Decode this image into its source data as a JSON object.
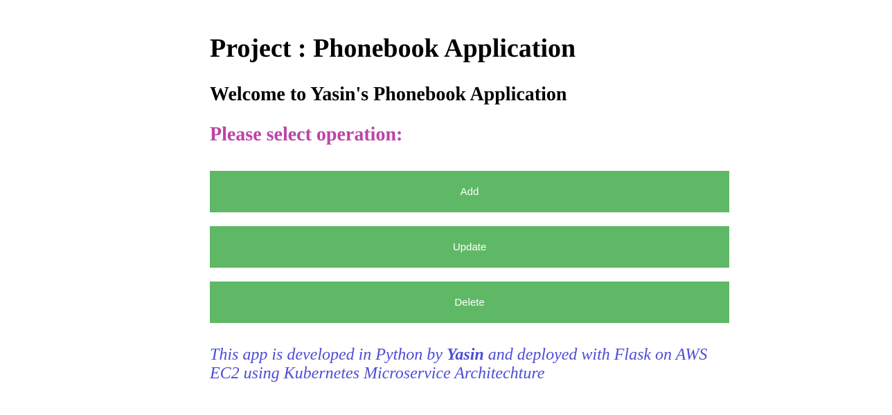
{
  "header": {
    "title": "Project : Phonebook Application",
    "welcome": "Welcome to Yasin's Phonebook Application",
    "prompt": "Please select operation:"
  },
  "operations": [
    {
      "label": "Add"
    },
    {
      "label": "Update"
    },
    {
      "label": "Delete"
    }
  ],
  "footer": {
    "text_before": "This app is developed in Python by ",
    "author": "Yasin",
    "text_after": " and deployed with Flask on AWS EC2 using Kubernetes Microservice Architechture"
  },
  "colors": {
    "button_bg": "#5fb865",
    "button_text": "#ffffff",
    "prompt": "#bb44a8",
    "footer": "#4d4dd6"
  }
}
